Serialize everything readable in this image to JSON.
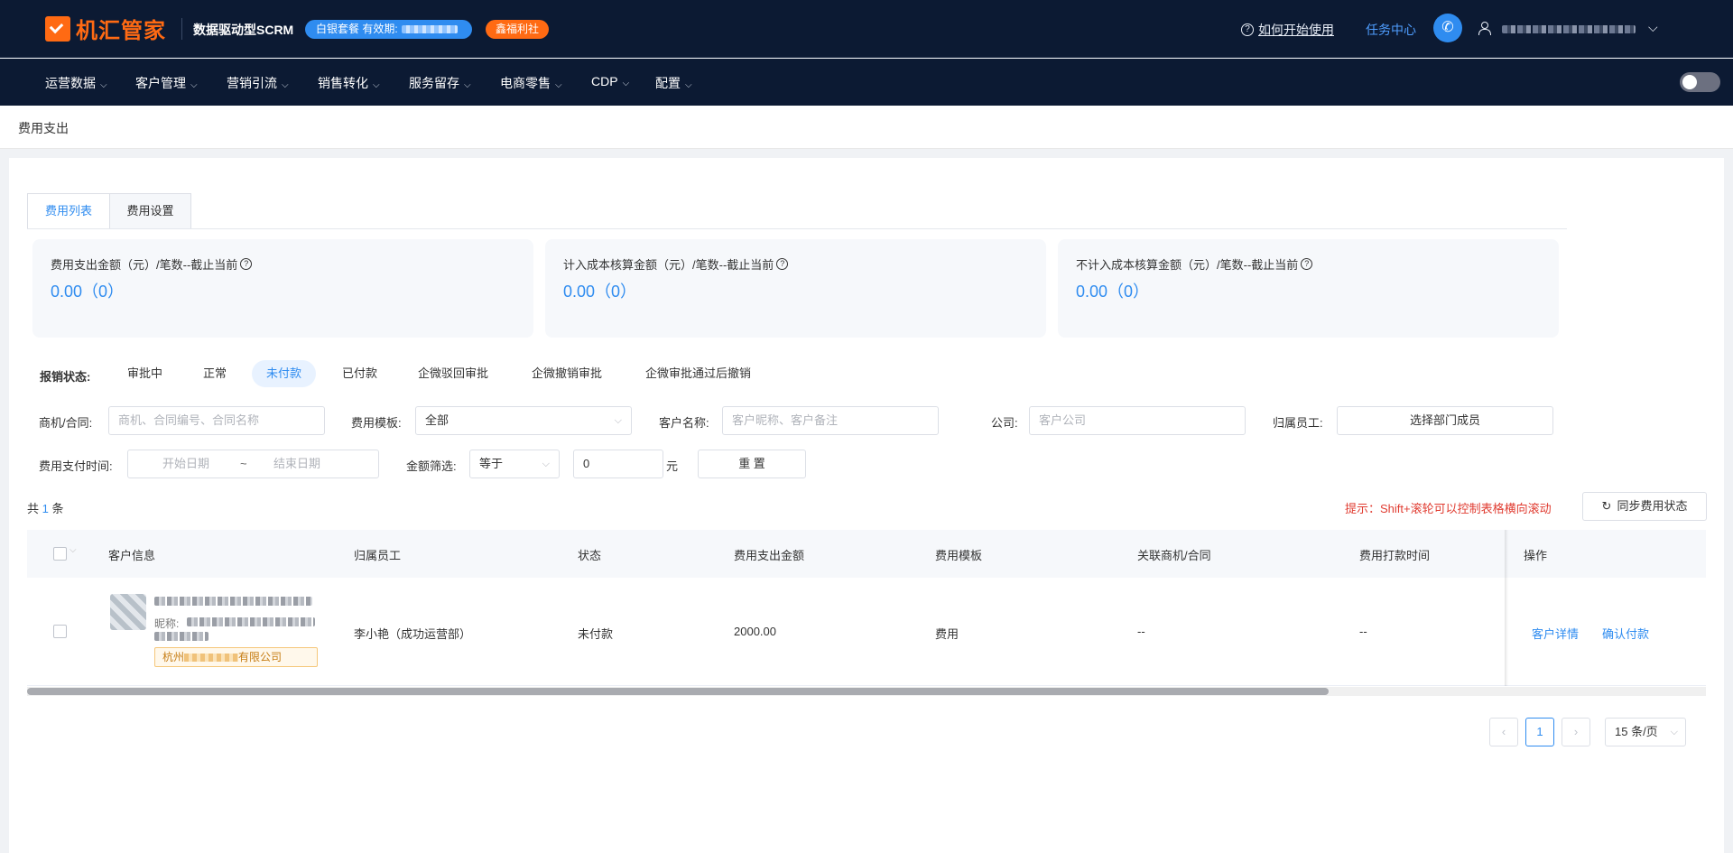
{
  "header": {
    "brand": "机汇管家",
    "product": "数据驱动型SCRM",
    "plan_label": "白银套餐 有效期:",
    "welfare_label": "鑫福利社",
    "help_label": "如何开始使用",
    "task_center_label": "任务中心"
  },
  "nav": {
    "items": [
      {
        "label": "运营数据"
      },
      {
        "label": "客户管理"
      },
      {
        "label": "营销引流"
      },
      {
        "label": "销售转化"
      },
      {
        "label": "服务留存"
      },
      {
        "label": "电商零售"
      },
      {
        "label": "CDP"
      },
      {
        "label": "配置"
      }
    ]
  },
  "page": {
    "title": "费用支出"
  },
  "tabs": [
    {
      "label": "费用列表",
      "active": true
    },
    {
      "label": "费用设置",
      "active": false
    }
  ],
  "stats": [
    {
      "title": "费用支出金额（元）/笔数--截止当前",
      "value": "0.00（0）"
    },
    {
      "title": "计入成本核算金额（元）/笔数--截止当前",
      "value": "0.00（0）"
    },
    {
      "title": "不计入成本核算金额（元）/笔数--截止当前",
      "value": "0.00（0）"
    }
  ],
  "status_filter": {
    "label": "报销状态:",
    "options": [
      {
        "label": "审批中",
        "active": false
      },
      {
        "label": "正常",
        "active": false
      },
      {
        "label": "未付款",
        "active": true
      },
      {
        "label": "已付款",
        "active": false
      },
      {
        "label": "企微驳回审批",
        "active": false
      },
      {
        "label": "企微撤销审批",
        "active": false
      },
      {
        "label": "企微审批通过后撤销",
        "active": false
      }
    ]
  },
  "filters": {
    "opportunity_label": "商机/合同:",
    "opportunity_placeholder": "商机、合同编号、合同名称",
    "template_label": "费用模板:",
    "template_value": "全部",
    "customer_label": "客户名称:",
    "customer_placeholder": "客户昵称、客户备注",
    "company_label": "公司:",
    "company_placeholder": "客户公司",
    "employee_label": "归属员工:",
    "employee_button": "选择部门成员",
    "pay_time_label": "费用支付时间:",
    "start_date_placeholder": "开始日期",
    "date_sep": "~",
    "end_date_placeholder": "结束日期",
    "amount_label": "金额筛选:",
    "amount_op": "等于",
    "amount_value": "0",
    "amount_unit": "元",
    "reset_label": "重 置"
  },
  "summary": {
    "total_prefix": "共",
    "total_count": "1",
    "total_suffix": "条",
    "tip": "提示：Shift+滚轮可以控制表格横向滚动",
    "sync_label": "同步费用状态"
  },
  "table": {
    "columns": [
      "客户信息",
      "归属员工",
      "状态",
      "费用支出金额",
      "费用模板",
      "关联商机/合同",
      "费用打款时间",
      "操作"
    ],
    "rows": [
      {
        "nick_label": "昵称:",
        "company": "杭州",
        "company_suffix": "有限公司",
        "employee": "李小艳（成功运营部）",
        "status": "未付款",
        "amount": "2000.00",
        "template": "费用",
        "opportunity": "--",
        "pay_time": "--",
        "actions": [
          "客户详情",
          "确认付款"
        ]
      }
    ]
  },
  "pagination": {
    "current_page": "1",
    "page_size": "15 条/页"
  }
}
